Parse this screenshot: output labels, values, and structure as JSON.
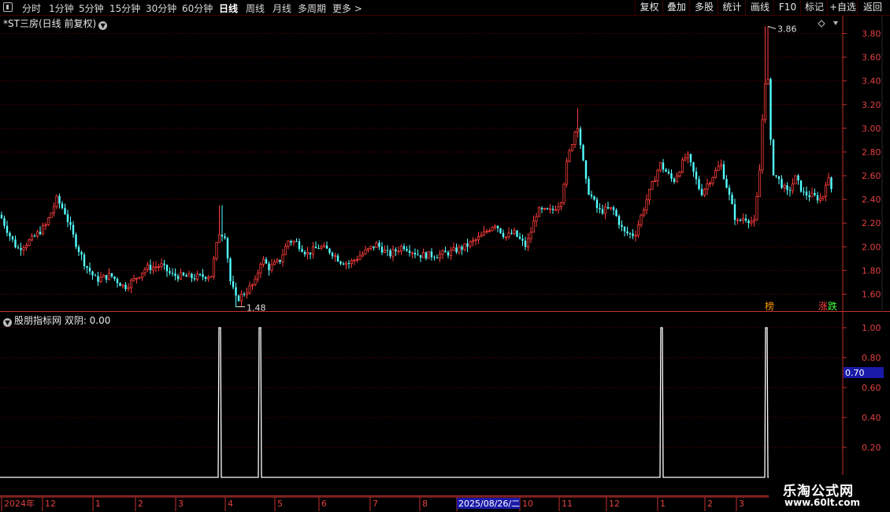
{
  "toolbar": {
    "periods": [
      "分时",
      "1分钟",
      "5分钟",
      "15分钟",
      "30分钟",
      "60分钟",
      "日线",
      "周线",
      "月线",
      "多周期",
      "更多 >"
    ],
    "active_period": "日线",
    "right_buttons": [
      "复权",
      "叠加",
      "多股",
      "统计",
      "画线",
      "F10",
      "标记",
      "+自选",
      "返回"
    ]
  },
  "main_chart": {
    "title": "*ST三房(日线 前复权)",
    "high_label": "3.86",
    "low_label": "1.48",
    "axis_ticks": [
      "3.80",
      "3.60",
      "3.40",
      "3.20",
      "3.00",
      "2.80",
      "2.60",
      "2.40",
      "2.20",
      "2.00",
      "1.80",
      "1.60"
    ],
    "tag_bang": "榜",
    "tag_zhang": "涨",
    "tag_die": "跌"
  },
  "sub_chart": {
    "title": "股朋指标网 双阴: 0.00",
    "axis_ticks": [
      "1.00",
      "0.80",
      "0.60",
      "0.40",
      "0.20"
    ],
    "current_value_label": "0.70"
  },
  "time_axis": {
    "labels": [
      "2024年",
      "12",
      "1",
      "2",
      "3",
      "4",
      "5",
      "6",
      "7",
      "8",
      "9",
      "10",
      "11",
      "12",
      "1",
      "2",
      "3"
    ],
    "cursor_date": "2025/08/26/二"
  },
  "watermark": {
    "line1": "乐淘公式网",
    "line2": "www.60lt.com"
  },
  "colors": {
    "up": "#ff3c3c",
    "down": "#54ffff",
    "grid": "#7a0000",
    "axis": "#c23030",
    "signal": "#ffffff"
  },
  "chart_data": [
    {
      "type": "candlestick",
      "title": "*ST三房(日线 前复权)",
      "ylim": [
        1.45,
        3.95
      ],
      "annotations": [
        {
          "text": "3.86",
          "value": 3.86
        },
        {
          "text": "1.48",
          "value": 1.48
        }
      ],
      "months": [
        "2024-11",
        "2024-12",
        "2025-01",
        "2025-02",
        "2025-03",
        "2025-04",
        "2025-05",
        "2025-06",
        "2025-07",
        "2025-08",
        "2025-09",
        "2025-10",
        "2025-11",
        "2025-12",
        "2026-01",
        "2026-02",
        "2026-03"
      ],
      "approx_monthly_close": [
        2.25,
        2.05,
        1.75,
        1.75,
        1.75,
        1.65,
        1.95,
        1.95,
        1.85,
        1.95,
        1.95,
        2.15,
        2.9,
        2.25,
        2.65,
        2.55,
        2.4
      ]
    },
    {
      "type": "line",
      "title": "股朋指标网 双阴: 0.00",
      "ylim": [
        0,
        1.1
      ],
      "signals_at_months": [
        "2025-04",
        "2025-05",
        "2026-01",
        "2026-03"
      ],
      "signal_value": 1.0
    }
  ]
}
